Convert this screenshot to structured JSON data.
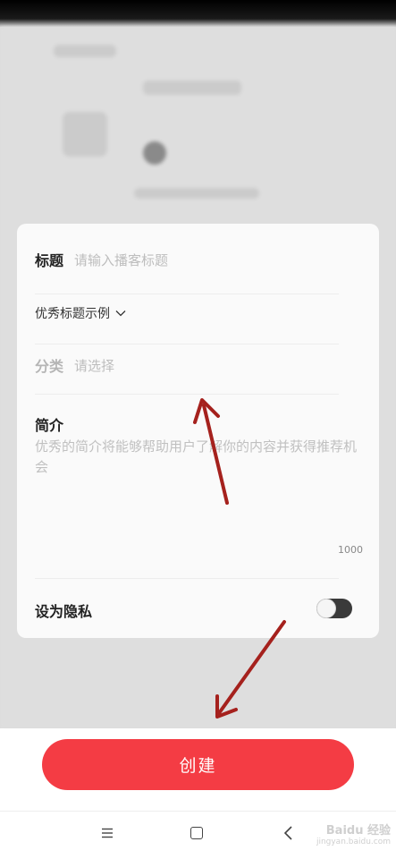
{
  "form": {
    "title_label": "标题",
    "title_placeholder": "请输入播客标题",
    "title_examples_label": "优秀标题示例",
    "category_label": "分类",
    "category_placeholder": "请选择",
    "intro_label": "简介",
    "intro_placeholder": "优秀的简介将能够帮助用户了解你的内容并获得推荐机会",
    "intro_char_limit": "1000",
    "private_label": "设为隐私",
    "private_enabled": false
  },
  "actions": {
    "create_label": "创建"
  },
  "watermark": {
    "logo_text": "Baidu 经验",
    "url_text": "jingyan.baidu.com"
  },
  "colors": {
    "primary": "#f43c44",
    "annotation_arrow": "#a5211d"
  },
  "icons": {
    "examples_toggle": "chevron-down-icon",
    "nav_menu": "menu-icon",
    "nav_home": "home-square-icon",
    "nav_back": "back-chevron-icon"
  }
}
